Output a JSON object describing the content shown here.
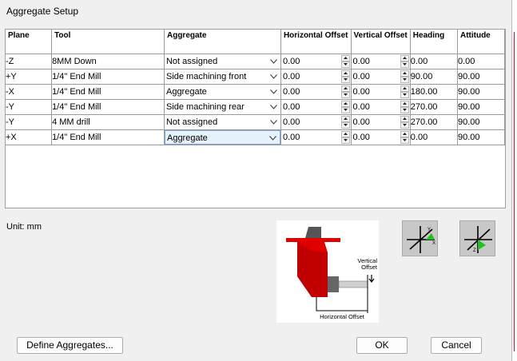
{
  "window": {
    "title": "Aggregate Setup"
  },
  "grid": {
    "headers": [
      "Plane",
      "Tool",
      "Aggregate",
      "Horizontal Offset",
      "Vertical Offset",
      "Heading",
      "Attitude"
    ],
    "rows": [
      {
        "plane": "-Z",
        "tool": "8MM Down",
        "aggregate": "Not assigned",
        "h_offset": "0.00",
        "v_offset": "0.00",
        "heading": "0.00",
        "attitude": "0.00"
      },
      {
        "plane": "+Y",
        "tool": "1/4\" End Mill",
        "aggregate": "Side machining front",
        "h_offset": "0.00",
        "v_offset": "0.00",
        "heading": "90.00",
        "attitude": "90.00"
      },
      {
        "plane": "-X",
        "tool": "1/4\" End Mill",
        "aggregate": "Aggregate",
        "h_offset": "0.00",
        "v_offset": "0.00",
        "heading": "180.00",
        "attitude": "90.00"
      },
      {
        "plane": "-Y",
        "tool": "1/4\" End Mill",
        "aggregate": "Side machining rear",
        "h_offset": "0.00",
        "v_offset": "0.00",
        "heading": "270.00",
        "attitude": "90.00"
      },
      {
        "plane": "-Y",
        "tool": "4 MM drill",
        "aggregate": "Not assigned",
        "h_offset": "0.00",
        "v_offset": "0.00",
        "heading": "270.00",
        "attitude": "90.00"
      },
      {
        "plane": "+X",
        "tool": "1/4\" End Mill",
        "aggregate": "Aggregate",
        "h_offset": "0.00",
        "v_offset": "0.00",
        "heading": "0.00",
        "attitude": "90.00"
      }
    ],
    "selected_row": 5
  },
  "unit_label": "Unit: mm",
  "illustration": {
    "vertical_offset_label": "Vertical Offset",
    "horizontal_offset_label": "Horizontal Offset",
    "colors": {
      "body": "#e00000",
      "dark": "#8a0000",
      "axis": "#22c022"
    }
  },
  "axis_icons": [
    {
      "name": "axis-xy-icon",
      "labels": [
        "Y",
        "X"
      ]
    },
    {
      "name": "axis-z-icon",
      "labels": [
        "Z"
      ]
    }
  ],
  "buttons": {
    "define": "Define Aggregates...",
    "ok": "OK",
    "cancel": "Cancel"
  }
}
